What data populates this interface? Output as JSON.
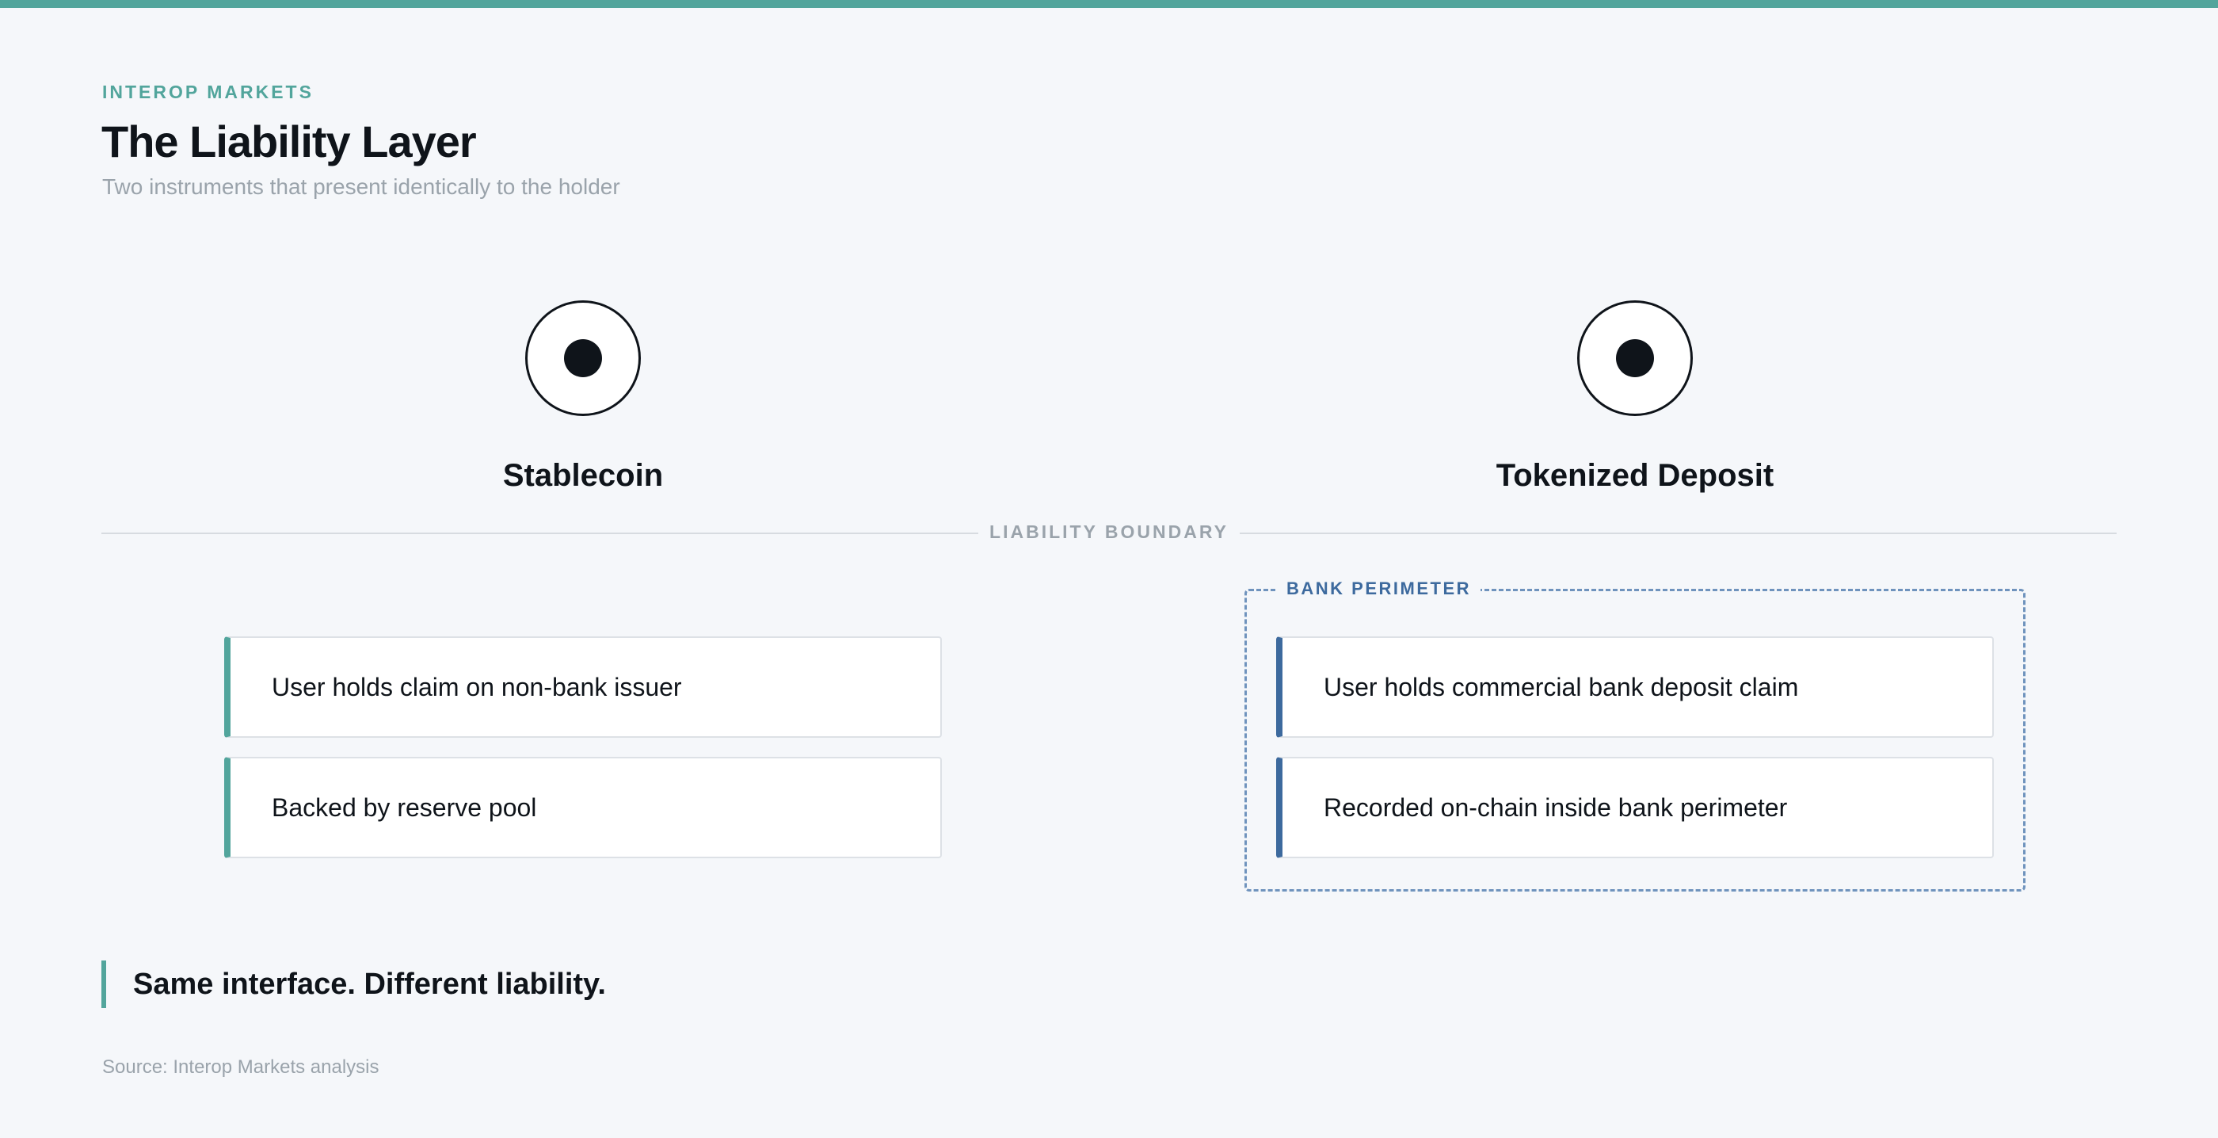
{
  "header": {
    "eyebrow": "INTEROP MARKETS",
    "title": "The Liability Layer",
    "subtitle": "Two instruments that present identically to the holder"
  },
  "columns": [
    {
      "title": "Stablecoin",
      "accent": "#52a59c",
      "items": [
        "User holds claim on non-bank issuer",
        "Backed by reserve pool"
      ]
    },
    {
      "title": "Tokenized Deposit",
      "accent": "#3d6a9e",
      "perimeter_label": "BANK PERIMETER",
      "items": [
        "User holds commercial bank deposit claim",
        "Recorded on-chain inside bank perimeter"
      ]
    }
  ],
  "boundary_label": "LIABILITY BOUNDARY",
  "takeaway": "Same interface. Different liability.",
  "source": "Source: Interop Markets analysis",
  "colors": {
    "accent_teal": "#52a59c",
    "accent_blue": "#3d6a9e",
    "ink": "#0f141a",
    "muted": "#9aa3ab",
    "background": "#f5f7fa"
  },
  "icons": [
    "holder-icon"
  ]
}
